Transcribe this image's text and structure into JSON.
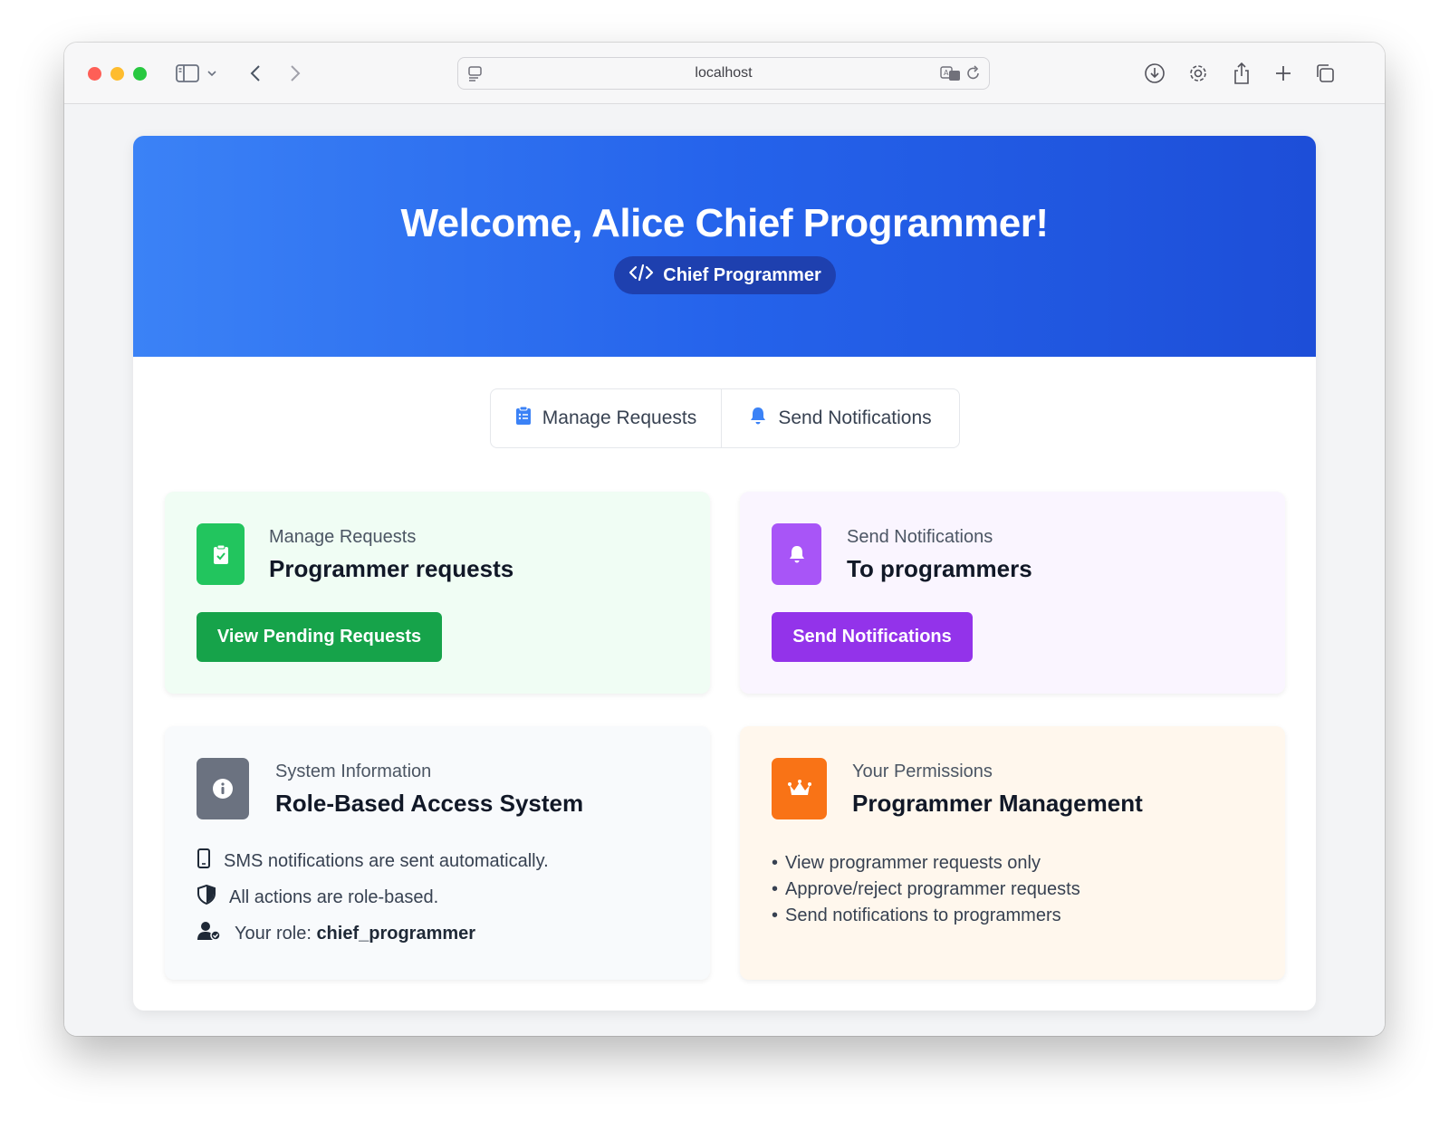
{
  "browser": {
    "url": "localhost"
  },
  "hero": {
    "title": "Welcome, Alice Chief Programmer!",
    "role_badge": "Chief Programmer"
  },
  "tabs": [
    {
      "label": "Manage Requests",
      "icon": "clipboard-icon"
    },
    {
      "label": "Send Notifications",
      "icon": "bell-icon"
    }
  ],
  "cards": {
    "manage": {
      "subtitle": "Manage Requests",
      "heading": "Programmer requests",
      "button": "View Pending Requests",
      "color": "#16a34a"
    },
    "notify": {
      "subtitle": "Send Notifications",
      "heading": "To programmers",
      "button": "Send Notifications",
      "color": "#9333ea"
    },
    "system": {
      "subtitle": "System Information",
      "heading": "Role-Based Access System",
      "rows": [
        {
          "icon": "mobile-icon",
          "text": "SMS notifications are sent automatically."
        },
        {
          "icon": "shield-icon",
          "text": "All actions are role-based."
        },
        {
          "icon": "user-icon",
          "label": "Your role:",
          "value": "chief_programmer"
        }
      ],
      "color": "#6b7280"
    },
    "permissions": {
      "subtitle": "Your Permissions",
      "heading": "Programmer Management",
      "items": [
        "View programmer requests only",
        "Approve/reject programmer requests",
        "Send notifications to programmers"
      ],
      "color": "#f97316"
    }
  }
}
